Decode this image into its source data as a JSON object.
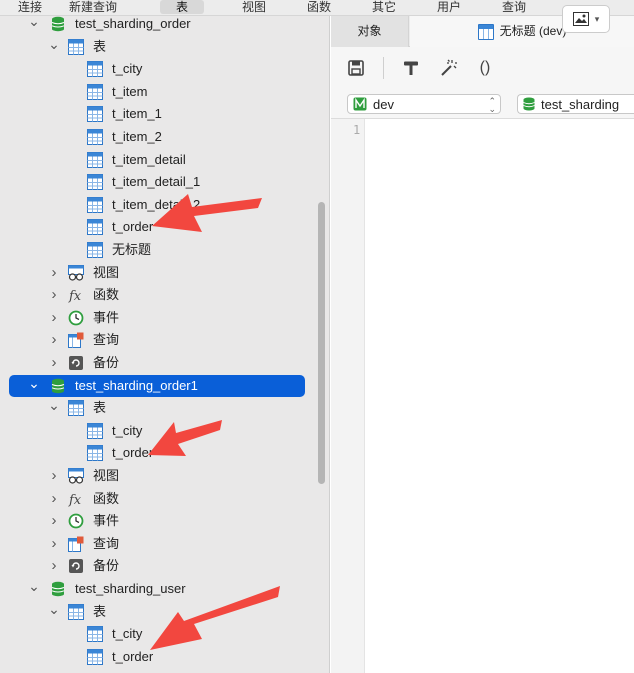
{
  "menubar": {
    "items": [
      "连接",
      "新建查询",
      "表",
      "视图",
      "函数",
      "其它",
      "用户",
      "查询"
    ],
    "active": "表"
  },
  "tree": [
    {
      "id": "db1",
      "label": "test_sharding_order",
      "type": "db",
      "expanded": true,
      "depth": 0
    },
    {
      "id": "db1-tables",
      "label": "表",
      "type": "tables",
      "expanded": true,
      "depth": 1
    },
    {
      "id": "db1-t1",
      "label": "t_city",
      "type": "table",
      "depth": 2
    },
    {
      "id": "db1-t2",
      "label": "t_item",
      "type": "table",
      "depth": 2
    },
    {
      "id": "db1-t3",
      "label": "t_item_1",
      "type": "table",
      "depth": 2
    },
    {
      "id": "db1-t4",
      "label": "t_item_2",
      "type": "table",
      "depth": 2
    },
    {
      "id": "db1-t5",
      "label": "t_item_detail",
      "type": "table",
      "depth": 2
    },
    {
      "id": "db1-t6",
      "label": "t_item_detail_1",
      "type": "table",
      "depth": 2
    },
    {
      "id": "db1-t7",
      "label": "t_item_detail_2",
      "type": "table",
      "depth": 2
    },
    {
      "id": "db1-t8",
      "label": "t_order",
      "type": "table",
      "depth": 2
    },
    {
      "id": "db1-t9",
      "label": "无标题",
      "type": "table",
      "depth": 2
    },
    {
      "id": "db1-views",
      "label": "视图",
      "type": "views",
      "expanded": false,
      "depth": 1
    },
    {
      "id": "db1-funcs",
      "label": "函数",
      "type": "functions",
      "expanded": false,
      "depth": 1
    },
    {
      "id": "db1-events",
      "label": "事件",
      "type": "events",
      "expanded": false,
      "depth": 1
    },
    {
      "id": "db1-queries",
      "label": "查询",
      "type": "queries",
      "expanded": false,
      "depth": 1
    },
    {
      "id": "db1-backups",
      "label": "备份",
      "type": "backups",
      "expanded": false,
      "depth": 1
    },
    {
      "id": "db2",
      "label": "test_sharding_order1",
      "type": "db",
      "expanded": true,
      "depth": 0,
      "selected": true
    },
    {
      "id": "db2-tables",
      "label": "表",
      "type": "tables",
      "expanded": true,
      "depth": 1
    },
    {
      "id": "db2-t1",
      "label": "t_city",
      "type": "table",
      "depth": 2
    },
    {
      "id": "db2-t2",
      "label": "t_order",
      "type": "table",
      "depth": 2
    },
    {
      "id": "db2-views",
      "label": "视图",
      "type": "views",
      "expanded": false,
      "depth": 1
    },
    {
      "id": "db2-funcs",
      "label": "函数",
      "type": "functions",
      "expanded": false,
      "depth": 1
    },
    {
      "id": "db2-events",
      "label": "事件",
      "type": "events",
      "expanded": false,
      "depth": 1
    },
    {
      "id": "db2-queries",
      "label": "查询",
      "type": "queries",
      "expanded": false,
      "depth": 1
    },
    {
      "id": "db2-backups",
      "label": "备份",
      "type": "backups",
      "expanded": false,
      "depth": 1
    },
    {
      "id": "db3",
      "label": "test_sharding_user",
      "type": "db",
      "expanded": true,
      "depth": 0
    },
    {
      "id": "db3-tables",
      "label": "表",
      "type": "tables",
      "expanded": true,
      "depth": 1
    },
    {
      "id": "db3-t1",
      "label": "t_city",
      "type": "table",
      "depth": 2
    },
    {
      "id": "db3-t2",
      "label": "t_order",
      "type": "table",
      "depth": 2
    }
  ],
  "tabs": {
    "objects": "对象",
    "query": "无标题 (dev)"
  },
  "toolbar": {
    "save_icon": "save-icon",
    "build_icon": "hammer-icon",
    "beautify_icon": "magic-wand-icon",
    "parens": "()"
  },
  "selectors": {
    "connection": "dev",
    "database": "test_sharding"
  },
  "editor": {
    "line_numbers": [
      "1"
    ]
  },
  "colors": {
    "selected": "#0a5fd8",
    "db_icon": "#2f9e3e",
    "table_icon": "#2d77c8",
    "arrow": "#f2473f"
  }
}
